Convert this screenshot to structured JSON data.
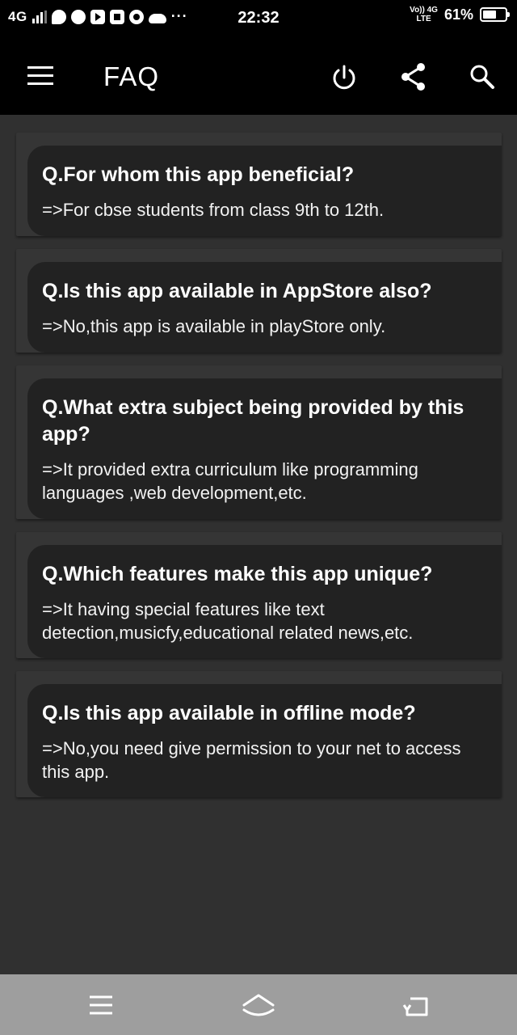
{
  "status_bar": {
    "network": "4G",
    "time": "22:32",
    "volte_top": "Vo)) 4G",
    "volte_bottom": "LTE",
    "battery_percent": "61%",
    "battery_level": 0.61,
    "notification_icons": [
      "signal-icon",
      "chat-icon",
      "check-icon",
      "play-icon",
      "mail-icon",
      "chrome-icon",
      "cloud-icon",
      "more-icon"
    ],
    "more": "···"
  },
  "app_bar": {
    "title": "FAQ",
    "icons": [
      "menu-icon",
      "power-icon",
      "share-icon",
      "search-icon"
    ]
  },
  "faq": [
    {
      "question": "Q.For whom this app beneficial?",
      "answer": "=>For cbse students from class 9th to 12th."
    },
    {
      "question": "Q.Is this app available in AppStore also?",
      "answer": "=>No,this app is available in playStore only."
    },
    {
      "question": "Q.What extra subject being provided by this app?",
      "answer": "=>It provided extra curriculum like programming languages ,web development,etc."
    },
    {
      "question": "Q.Which features make this app unique?",
      "answer": "=>It having special features like text detection,musicfy,educational related news,etc."
    },
    {
      "question": "Q.Is this app available in offline mode?",
      "answer": "=>No,you need give permission to your net to access this app."
    }
  ],
  "nav_bar": {
    "icons": [
      "recent-apps-icon",
      "home-icon",
      "back-icon"
    ]
  },
  "colors": {
    "background": "#303030",
    "app_bar": "#000000",
    "card_outer": "#353535",
    "card_inner": "#222222",
    "nav_bar": "#9e9e9e",
    "text": "#ffffff"
  }
}
